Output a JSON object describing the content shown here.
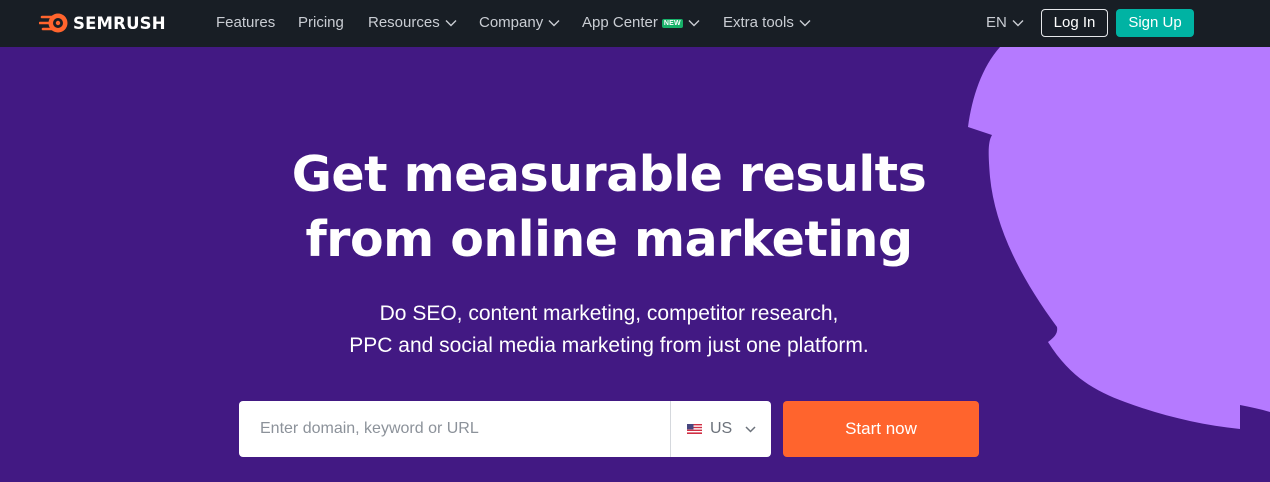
{
  "brand": {
    "name": "SEMRUSH",
    "logo_icon": "semrush-fireball-icon",
    "accent": "#ff642d"
  },
  "nav": {
    "items": [
      {
        "label": "Features",
        "has_dropdown": false
      },
      {
        "label": "Pricing",
        "has_dropdown": false
      },
      {
        "label": "Resources",
        "has_dropdown": true
      },
      {
        "label": "Company",
        "has_dropdown": true
      },
      {
        "label": "App Center",
        "has_dropdown": true,
        "badge": "NEW"
      },
      {
        "label": "Extra tools",
        "has_dropdown": true
      }
    ],
    "language": "EN",
    "login_label": "Log In",
    "signup_label": "Sign Up"
  },
  "hero": {
    "headline_line1": "Get measurable results",
    "headline_line2": "from online marketing",
    "sub_line1": "Do SEO, content marketing, competitor research,",
    "sub_line2": "PPC and social media marketing from just one platform."
  },
  "search": {
    "placeholder": "Enter domain, keyword or URL",
    "value": "",
    "database": "US",
    "database_icon": "us-flag-icon",
    "submit_label": "Start now"
  },
  "colors": {
    "topbar": "#181e25",
    "hero_bg": "#421983",
    "decoration": "#b57aff",
    "signup": "#00b3a3",
    "cta": "#ff642d"
  }
}
